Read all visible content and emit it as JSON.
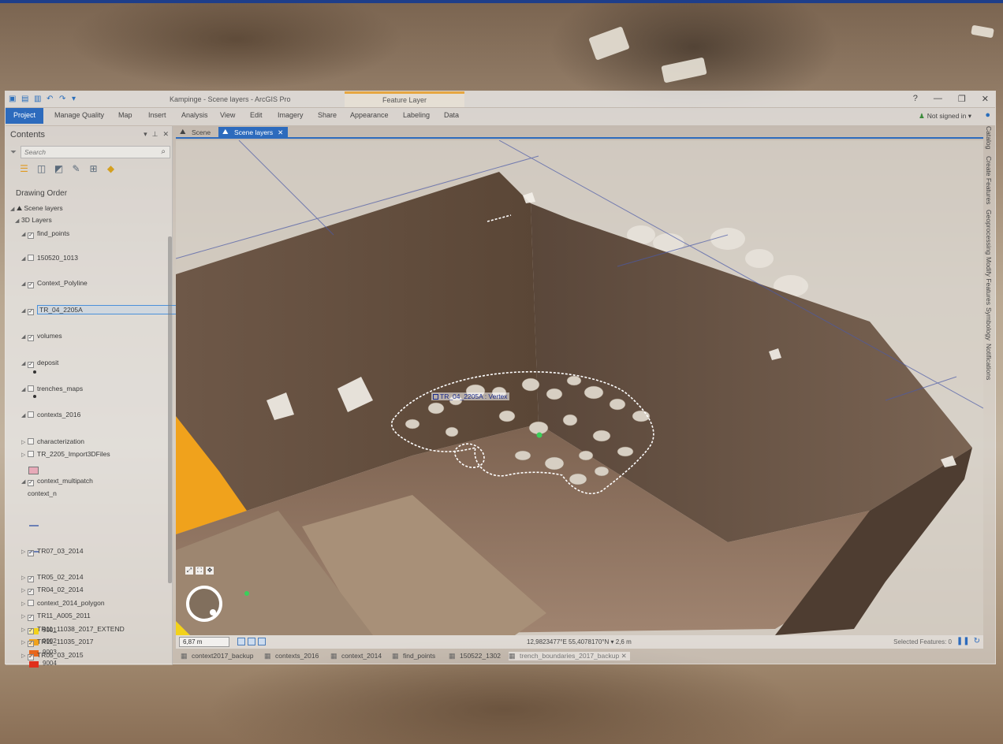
{
  "window": {
    "title": "Kampinge - Scene layers - ArcGIS Pro",
    "context_tab": "Feature Layer",
    "help": "?",
    "minimize": "—",
    "restore": "❐",
    "close": "✕"
  },
  "ribbon": {
    "tabs": [
      "Project",
      "Manage Quality",
      "Map",
      "Insert",
      "Analysis",
      "View",
      "Edit",
      "Imagery",
      "Share",
      "Appearance",
      "Labeling",
      "Data"
    ],
    "sign_in": "Not signed in ▾"
  },
  "contents": {
    "title": "Contents",
    "search_placeholder": "Search",
    "section": "Drawing Order",
    "layers": {
      "scene_layers": "Scene layers",
      "3d_layers": "3D Layers",
      "find_points": "find_points",
      "l150520": "150520_1013",
      "context_polyline": "Context_Polyline",
      "tr_04": "TR_04_2205A",
      "volumes": "volumes",
      "deposit": "deposit",
      "trenches_maps": "trenches_maps",
      "contexts_2016": "contexts_2016",
      "characterization": "characterization",
      "tr_2205_import": "TR_2205_Import3DFiles",
      "context_multipatch": "context_multipatch",
      "context_n": "context_n",
      "tr07": "TR07_03_2014",
      "tr05_02": "TR05_02_2014",
      "tr04_02": "TR04_02_2014",
      "context_2014_polygon": "context_2014_polygon",
      "tr11_a005": "TR11_A005_2011",
      "tr11_11038": "TR11_11038_2017_EXTEND",
      "tr11_11035": "TR11_11035_2017",
      "tr05_03": "TR05_03_2015"
    },
    "legend": [
      {
        "label": "9001",
        "color": "#f3d21a"
      },
      {
        "label": "9002",
        "color": "#f0a21c"
      },
      {
        "label": "9003",
        "color": "#e8661c"
      },
      {
        "label": "9004",
        "color": "#e0301c"
      }
    ]
  },
  "view_tabs": {
    "scene": "Scene",
    "scene_layers": "Scene layers",
    "close": "✕"
  },
  "scene": {
    "vertex_label": "TR_04_2205A : Vertex"
  },
  "status": {
    "scale": "6,87 m",
    "coordinates": "12,9823477°E 55,4078170°N  ▾  2,6 m",
    "selected_features": "Selected Features: 0"
  },
  "bottom_tabs": [
    "context2017_backup",
    "contexts_2016",
    "context_2014",
    "find_points",
    "150522_1302",
    "trench_boundaries_2017_backup"
  ],
  "right_dock": [
    "Catalog",
    "Create Features",
    "Geoprocessing",
    "Modify Features",
    "Symbology",
    "Notifications"
  ],
  "colors": {
    "accent": "#2d6bbd",
    "context_tab": "#e6a640",
    "orange_patch": "#f0a21c"
  }
}
